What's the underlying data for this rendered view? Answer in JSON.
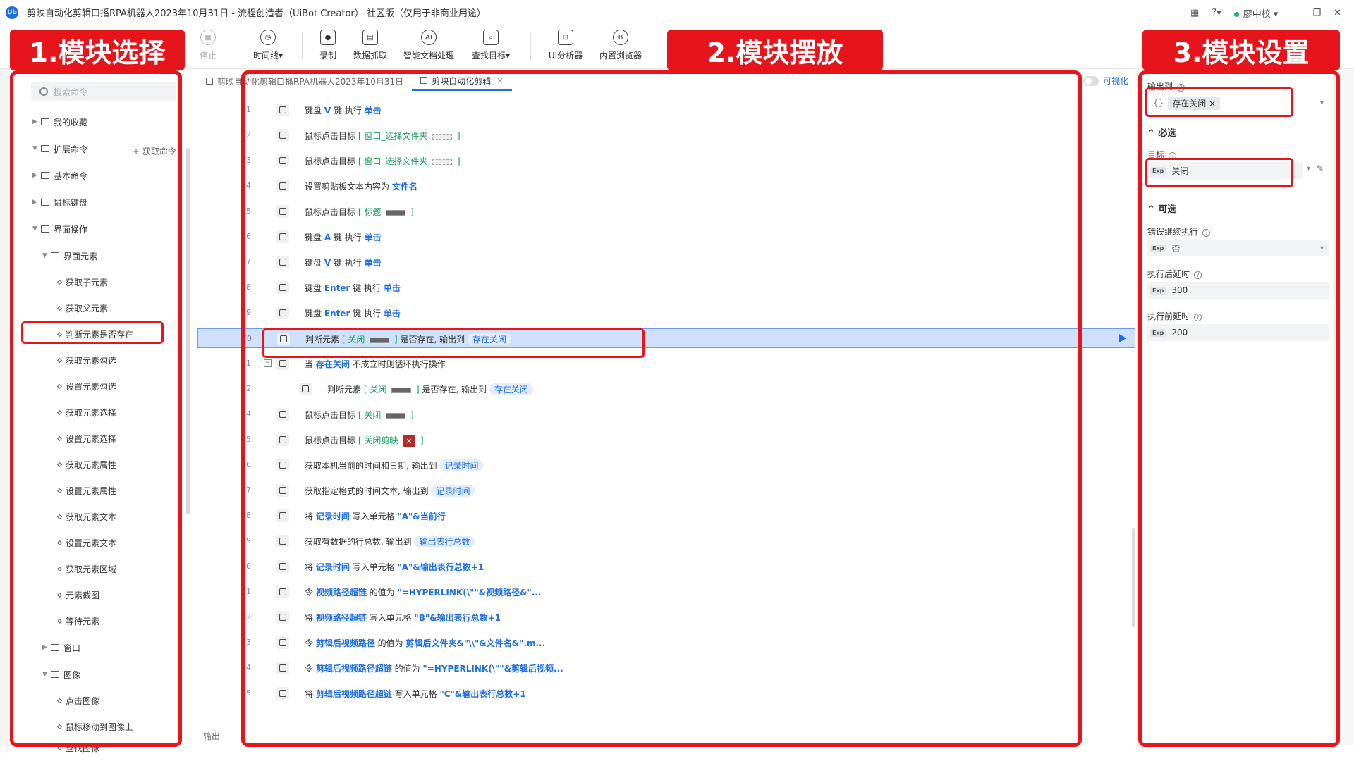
{
  "app": {
    "title": "剪映自动化剪辑口播RPA机器人2023年10月31日 - 流程创造者（UiBot Creator） 社区版（仅用于非商业用途）",
    "logo_text": "Ub",
    "user": "廖中校"
  },
  "toolbar": {
    "stop": "停止",
    "timeline": "时间线▾",
    "record": "录制",
    "data_capture": "数据抓取",
    "smart_doc": "智能文档处理",
    "find_target": "查找目标▾",
    "ui_analyzer": "UI分析器",
    "browser": "内置浏览器"
  },
  "annotations": {
    "label1": "1.模块选择",
    "label2": "2.模块摆放",
    "label3": "3.模块设置"
  },
  "left": {
    "search_placeholder": "搜索命令",
    "get_cmd": "+ 获取命令",
    "items": [
      {
        "label": "我的收藏"
      },
      {
        "label": "扩展命令"
      },
      {
        "label": "基本命令"
      },
      {
        "label": "鼠标键盘"
      },
      {
        "label": "界面操作"
      },
      {
        "label": "界面元素"
      },
      {
        "label": "获取子元素"
      },
      {
        "label": "获取父元素"
      },
      {
        "label": "判断元素是否存在"
      },
      {
        "label": "获取元素勾选"
      },
      {
        "label": "设置元素勾选"
      },
      {
        "label": "获取元素选择"
      },
      {
        "label": "设置元素选择"
      },
      {
        "label": "获取元素属性"
      },
      {
        "label": "设置元素属性"
      },
      {
        "label": "获取元素文本"
      },
      {
        "label": "设置元素文本"
      },
      {
        "label": "获取元素区域"
      },
      {
        "label": "元素截图"
      },
      {
        "label": "等待元素"
      },
      {
        "label": "窗口"
      },
      {
        "label": "图像"
      },
      {
        "label": "点击图像"
      },
      {
        "label": "鼠标移动到图像上"
      },
      {
        "label": "查找图像"
      }
    ]
  },
  "center": {
    "tab1": "剪映自动化剪辑口播RPA机器人2023年10月31日",
    "tab2": "剪映自动化剪辑",
    "visual_toggle": "可视化",
    "output": "输出",
    "lines": [
      {
        "no": "61",
        "parts": [
          "键盘 ",
          "V",
          " 键 执行 ",
          "单击"
        ]
      },
      {
        "no": "62",
        "parts": [
          "鼠标点击目标 ",
          "[ 窗口_选择文件夹 ",
          "",
          " ]"
        ]
      },
      {
        "no": "63",
        "parts": [
          "鼠标点击目标 ",
          "[ 窗口_选择文件夹 ",
          "",
          " ]"
        ]
      },
      {
        "no": "64",
        "parts": [
          "设置剪贴板文本内容为 ",
          "文件名"
        ]
      },
      {
        "no": "65",
        "parts": [
          "鼠标点击目标 ",
          "[ 标题 ",
          "",
          " ]"
        ]
      },
      {
        "no": "66",
        "parts": [
          "键盘 ",
          "A",
          " 键 执行 ",
          "单击"
        ]
      },
      {
        "no": "67",
        "parts": [
          "键盘 ",
          "V",
          " 键 执行 ",
          "单击"
        ]
      },
      {
        "no": "68",
        "parts": [
          "键盘 ",
          "Enter",
          " 键 执行 ",
          "单击"
        ]
      },
      {
        "no": "69",
        "parts": [
          "键盘 ",
          "Enter",
          " 键 执行 ",
          "单击"
        ]
      },
      {
        "no": "70",
        "parts": [
          "判断元素 ",
          "[ 关闭 ",
          "",
          " ]",
          " 是否存在, 输出到 ",
          "存在关闭"
        ]
      },
      {
        "no": "71",
        "parts": [
          "当 ",
          "存在关闭",
          " 不成立时则循环执行操作"
        ]
      },
      {
        "no": "72",
        "parts": [
          "判断元素 ",
          "[ 关闭 ",
          "",
          " ]",
          " 是否存在, 输出到 ",
          "存在关闭"
        ]
      },
      {
        "no": "74",
        "parts": [
          "鼠标点击目标 ",
          "[ 关闭 ",
          "",
          " ]"
        ]
      },
      {
        "no": "75",
        "parts": [
          "鼠标点击目标 ",
          "[ 关闭剪映 ",
          "×",
          " ]"
        ]
      },
      {
        "no": "76",
        "parts": [
          "获取本机当前的时间和日期, 输出到 ",
          "记录时间"
        ]
      },
      {
        "no": "77",
        "parts": [
          "获取指定格式的时间文本, 输出到 ",
          "记录时间"
        ]
      },
      {
        "no": "78",
        "parts": [
          "将 ",
          "记录时间",
          " 写入单元格 ",
          "\"A\"&当前行"
        ]
      },
      {
        "no": "79",
        "parts": [
          "获取有数据的行总数, 输出到 ",
          "输出表行总数"
        ]
      },
      {
        "no": "80",
        "parts": [
          "将 ",
          "记录时间",
          " 写入单元格 ",
          "\"A\"&输出表行总数+1"
        ]
      },
      {
        "no": "81",
        "parts": [
          "令 ",
          "视频路径超链",
          " 的值为 ",
          "\"=HYPERLINK(\\\"\"&视频路径&\"..."
        ]
      },
      {
        "no": "82",
        "parts": [
          "将 ",
          "视频路径超链",
          " 写入单元格 ",
          "\"B\"&输出表行总数+1"
        ]
      },
      {
        "no": "83",
        "parts": [
          "令 ",
          "剪辑后视频路径",
          " 的值为 ",
          "剪辑后文件夹&\"\\\\\"&文件名&\".m..."
        ]
      },
      {
        "no": "84",
        "parts": [
          "令 ",
          "剪辑后视频路径超链",
          " 的值为 ",
          "\"=HYPERLINK(\\\"\"&剪辑后视频..."
        ]
      },
      {
        "no": "85",
        "parts": [
          "将 ",
          "剪辑后视频路径超链",
          " 写入单元格 ",
          "\"C\"&输出表行总数+1"
        ]
      }
    ]
  },
  "right": {
    "output_label": "输出到",
    "output_value": "存在关闭",
    "required": "必选",
    "target_label": "目标",
    "target_value": "关闭",
    "optional": "可选",
    "continue_label": "错误继续执行",
    "continue_value": "否",
    "after_label": "执行后延时",
    "after_value": "300",
    "before_label": "执行前延时",
    "before_value": "200",
    "exp": "Exp"
  },
  "colors": {
    "accent": "#1f6fe5",
    "annotation": "#e8141b",
    "selected_row": "#cfe0fb"
  }
}
